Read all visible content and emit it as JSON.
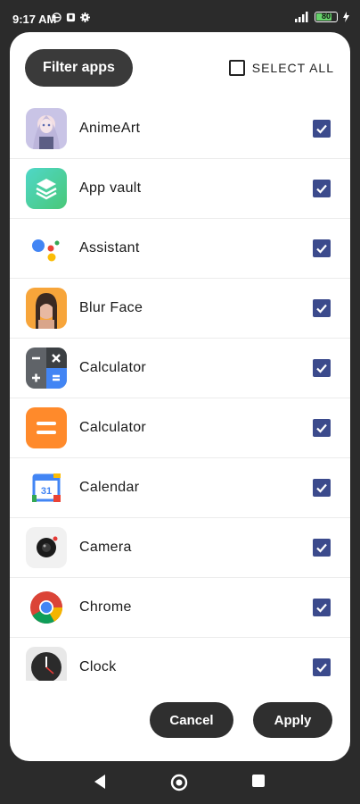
{
  "status_bar": {
    "time": "9:17 AM",
    "battery_level": "80",
    "battery_fraction": 0.8
  },
  "dialog": {
    "filter_label": "Filter apps",
    "select_all_label": "SELECT ALL",
    "select_all_checked": false,
    "apps": [
      {
        "name": "AnimeArt",
        "icon": "animeart-icon",
        "checked": true
      },
      {
        "name": "App vault",
        "icon": "app-vault-icon",
        "checked": true
      },
      {
        "name": "Assistant",
        "icon": "assistant-icon",
        "checked": true
      },
      {
        "name": "Blur Face",
        "icon": "blur-face-icon",
        "checked": true
      },
      {
        "name": "Calculator",
        "icon": "calculator-dark-icon",
        "checked": true
      },
      {
        "name": "Calculator",
        "icon": "calculator-orange-icon",
        "checked": true
      },
      {
        "name": "Calendar",
        "icon": "calendar-icon",
        "checked": true
      },
      {
        "name": "Camera",
        "icon": "camera-icon",
        "checked": true
      },
      {
        "name": "Chrome",
        "icon": "chrome-icon",
        "checked": true
      },
      {
        "name": "Clock",
        "icon": "clock-icon",
        "checked": true
      }
    ],
    "cancel_label": "Cancel",
    "apply_label": "Apply"
  },
  "colors": {
    "checkbox": "#3b4a8c",
    "dark_button": "#2f2f2f",
    "background": "#2b2b2b"
  }
}
